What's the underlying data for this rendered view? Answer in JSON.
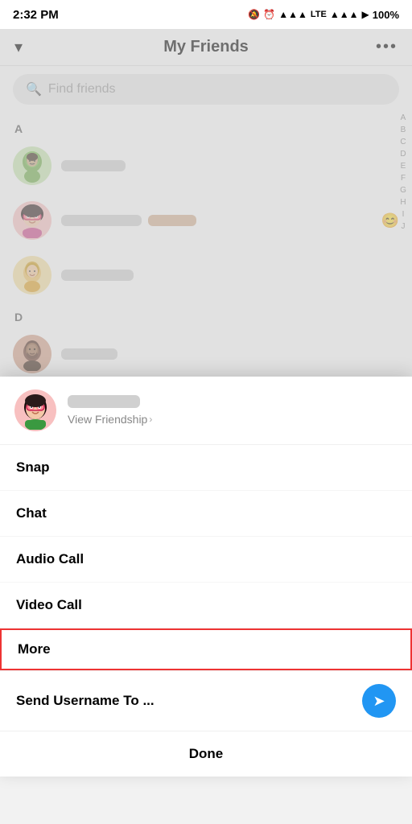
{
  "statusBar": {
    "time": "2:32 PM",
    "battery": "100%",
    "icons": "🔕 ⏰ 📶 LTE 📶 ▶ 🔋"
  },
  "header": {
    "title": "My Friends",
    "chevron": "▾",
    "moreMenu": "•••"
  },
  "search": {
    "placeholder": "Find friends",
    "icon": "🔍"
  },
  "sections": [
    {
      "letter": "A",
      "friends": [
        {
          "id": 1,
          "avatarType": "green"
        },
        {
          "id": 2,
          "avatarType": "pink",
          "hasExtra": true
        },
        {
          "id": 3,
          "avatarType": "yellow"
        }
      ]
    },
    {
      "letter": "D",
      "friends": [
        {
          "id": 4,
          "avatarType": "brown"
        }
      ]
    }
  ],
  "alphaIndex": [
    "A",
    "B",
    "C",
    "D",
    "E",
    "F",
    "G",
    "H",
    "I",
    "J"
  ],
  "overlay": {
    "viewFriendship": "View Friendship",
    "menuItems": [
      {
        "id": "snap",
        "label": "Snap"
      },
      {
        "id": "chat",
        "label": "Chat"
      },
      {
        "id": "audio-call",
        "label": "Audio Call"
      },
      {
        "id": "video-call",
        "label": "Video Call"
      },
      {
        "id": "more",
        "label": "More"
      }
    ],
    "sendUsername": "Send Username To ...",
    "done": "Done"
  }
}
